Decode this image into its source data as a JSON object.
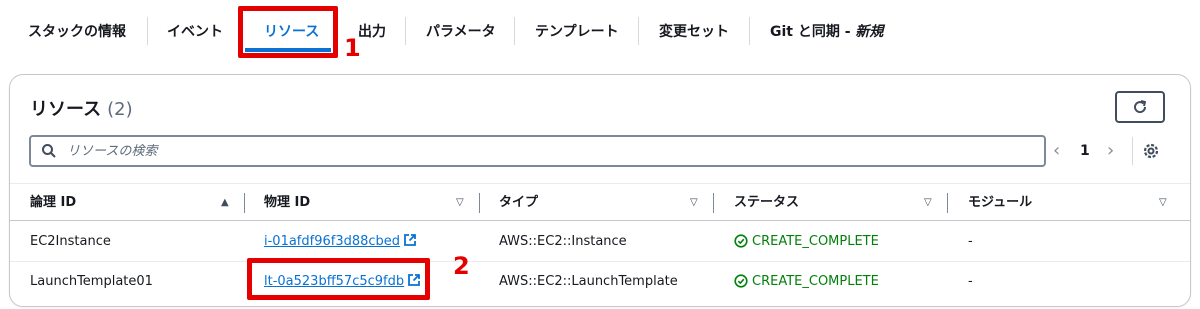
{
  "tabs": [
    {
      "label": "スタックの情報"
    },
    {
      "label": "イベント"
    },
    {
      "label": "リソース"
    },
    {
      "label": "出力"
    },
    {
      "label": "パラメータ"
    },
    {
      "label": "テンプレート"
    },
    {
      "label": "変更セット"
    },
    {
      "label": "Git と同期 - ",
      "badge": "新規"
    }
  ],
  "annotations": {
    "one": "1",
    "two": "2"
  },
  "panel": {
    "title": "リソース",
    "count": "(2)",
    "search_placeholder": "リソースの検索",
    "page": "1"
  },
  "table": {
    "headers": [
      "論理 ID",
      "物理 ID",
      "タイプ",
      "ステータス",
      "モジュール"
    ],
    "rows": [
      {
        "logical_id": "EC2Instance",
        "physical_id": "i-01afdf96f3d88cbed",
        "type": "AWS::EC2::Instance",
        "status": "CREATE_COMPLETE",
        "module": "-"
      },
      {
        "logical_id": "LaunchTemplate01",
        "physical_id": "lt-0a523bff57c5c9fdb",
        "type": "AWS::EC2::LaunchTemplate",
        "status": "CREATE_COMPLETE",
        "module": "-"
      }
    ]
  },
  "colors": {
    "accent": "#0972d3",
    "success": "#037f0c",
    "annotation": "#e50000"
  },
  "icons": [
    "refresh-icon",
    "search-icon",
    "settings-gear-icon",
    "external-link-icon",
    "success-check-icon",
    "sort-ascending-icon",
    "sort-icon"
  ]
}
